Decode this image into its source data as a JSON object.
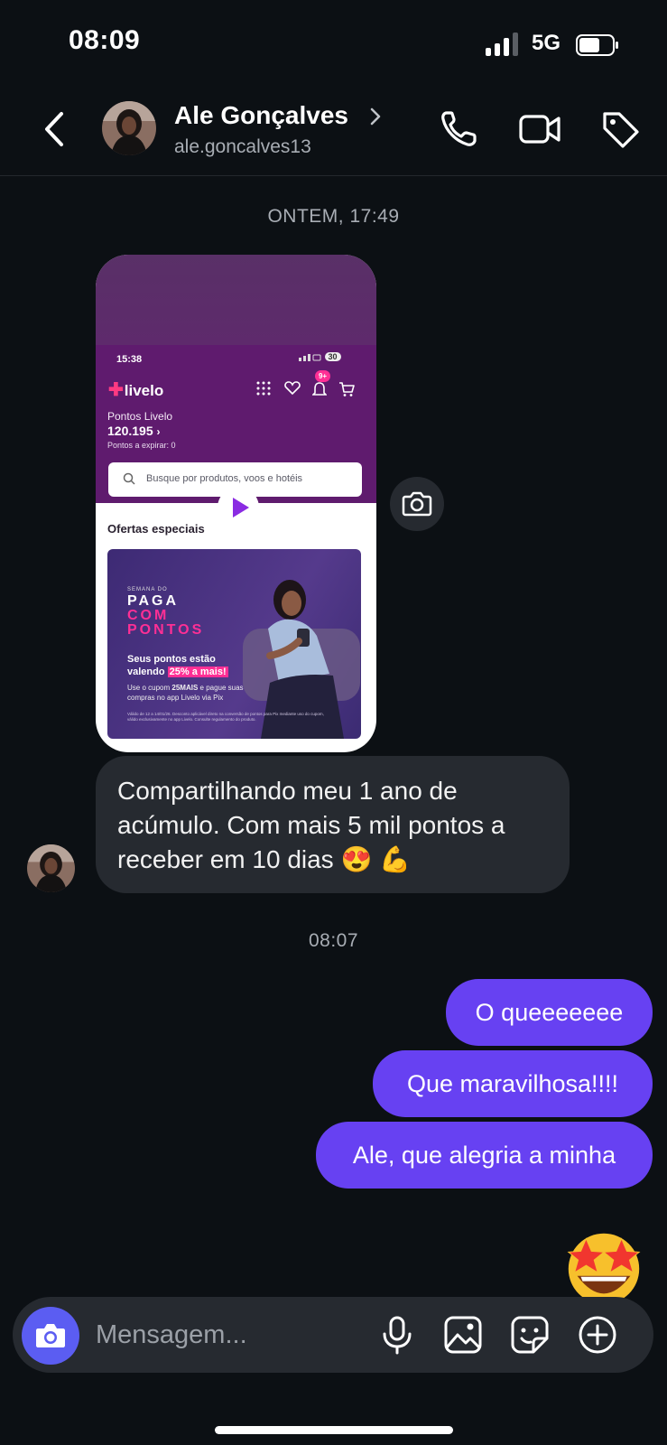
{
  "status_bar": {
    "time": "08:09",
    "network": "5G"
  },
  "header": {
    "contact_name": "Ale Gonçalves",
    "username": "ale.goncalves13"
  },
  "thread": {
    "timestamp_1": "ONTEM, 17:49",
    "timestamp_2": "08:07",
    "shared_post": {
      "status_time": "15:38",
      "battery_pct": "30",
      "brand": "livelo",
      "notifications_badge": "9+",
      "points_label": "Pontos Livelo",
      "points_value": "120.195",
      "points_expire": "Pontos a expirar: 0",
      "search_placeholder": "Busque por produtos, voos e hotéis",
      "section_title": "Ofertas especiais",
      "banner": {
        "kicker": "SEMANA DO",
        "line1": "PAGA",
        "line2": "COM",
        "line3": "PONTOS",
        "headline_a": "Seus pontos estão",
        "headline_b": "valendo",
        "headline_highlight": "25% a mais!",
        "body_a": "Use o cupom",
        "coupon": "25MAIS",
        "body_b": "e pague suas",
        "body_c": "compras no app Livelo via Pix",
        "fine_print": "Válido de 12 a 14/01/26. Desconto aplicável direto na conversão de pontos para Pix mediante uso do cupom, válido exclusivamente no app Livelo. Consulte regulamento do produto."
      }
    },
    "incoming_message": "Compartilhando meu 1 ano de acúmulo. Com mais 5 mil pontos a receber em 10 dias 😍 💪",
    "outgoing_messages": [
      "O queeeeeee",
      "Que maravilhosa!!!!",
      "Ale, que alegria a minha"
    ],
    "reaction_emoji": "🤩"
  },
  "composer": {
    "placeholder": "Mensagem..."
  },
  "colors": {
    "accent": "#6741f2",
    "camera_button": "#5b5df2",
    "incoming_bubble": "#262a30",
    "background": "#0c1014"
  }
}
